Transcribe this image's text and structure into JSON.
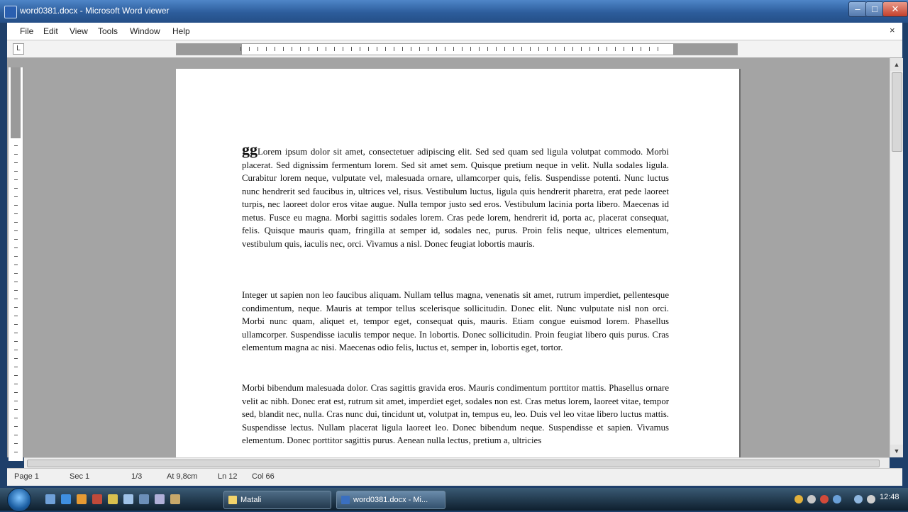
{
  "window": {
    "title": "word0381.docx - Microsoft Word viewer"
  },
  "menu": [
    "File",
    "Edit",
    "View",
    "Tools",
    "Window",
    "Help"
  ],
  "document": {
    "paragraphs": [
      {
        "dropcap": "gg",
        "text": "Lorem ipsum dolor sit amet, consectetuer adipiscing elit. Sed sed quam sed ligula volutpat commodo. Morbi placerat. Sed dignissim fermentum lorem. Sed sit amet sem. Quisque pretium neque in velit. Nulla sodales ligula. Curabitur lorem neque, vulputate vel, malesuada ornare, ullamcorper quis, felis. Suspendisse potenti. Nunc luctus nunc hendrerit sed faucibus in, ultrices vel, risus. Vestibulum luctus, ligula quis hendrerit pharetra, erat pede laoreet turpis, nec laoreet dolor eros vitae augue. Nulla tempor justo sed eros. Vestibulum lacinia porta libero. Maecenas id metus. Fusce eu magna. Morbi sagittis sodales lorem. Cras pede lorem, hendrerit id, porta ac, placerat consequat, felis. Quisque mauris quam, fringilla at semper id, sodales nec, purus. Proin felis neque, ultrices elementum, vestibulum quis, iaculis nec, orci. Vivamus a nisl. Donec feugiat lobortis mauris."
      },
      {
        "text": "Integer ut sapien non leo faucibus aliquam. Nullam tellus magna, venenatis sit amet, rutrum imperdiet, pellentesque condimentum, neque. Mauris at tempor tellus scelerisque sollicitudin. Donec elit. Nunc vulputate nisl non orci. Morbi nunc quam, aliquet et, tempor eget, consequat quis, mauris. Etiam congue euismod lorem. Phasellus ullamcorper. Suspendisse iaculis tempor neque. In lobortis. Donec sollicitudin. Proin feugiat libero quis purus. Cras elementum magna ac nisi. Maecenas odio felis, luctus et, semper in, lobortis eget, tortor."
      },
      {
        "text": "Morbi bibendum malesuada dolor. Cras sagittis gravida eros. Mauris condimentum porttitor mattis. Phasellus ornare velit ac nibh. Donec erat est, rutrum sit amet, imperdiet eget, sodales non est. Cras metus lorem, laoreet vitae, tempor sed, blandit nec, nulla. Cras nunc dui, tincidunt ut, volutpat in, tempus eu, leo. Duis vel leo vitae libero luctus mattis. Suspendisse lectus. Nullam placerat ligula laoreet leo. Donec bibendum neque. Suspendisse et sapien. Vivamus elementum. Donec porttitor sagittis purus. Aenean nulla lectus, pretium a, ultricies"
      }
    ]
  },
  "status": {
    "page": "Page 1",
    "section": "Sec 1",
    "pages": "1/3",
    "at": "At 9,8cm",
    "line": "Ln 12",
    "col": "Col 66"
  },
  "taskbar": {
    "buttons": [
      "Matali",
      "word0381.docx - Mi..."
    ],
    "clock": "12:48"
  },
  "colors": {
    "titlebar": "#2d5d9c",
    "page_background": "#a4a4a4",
    "taskbar": "#1e3348"
  }
}
